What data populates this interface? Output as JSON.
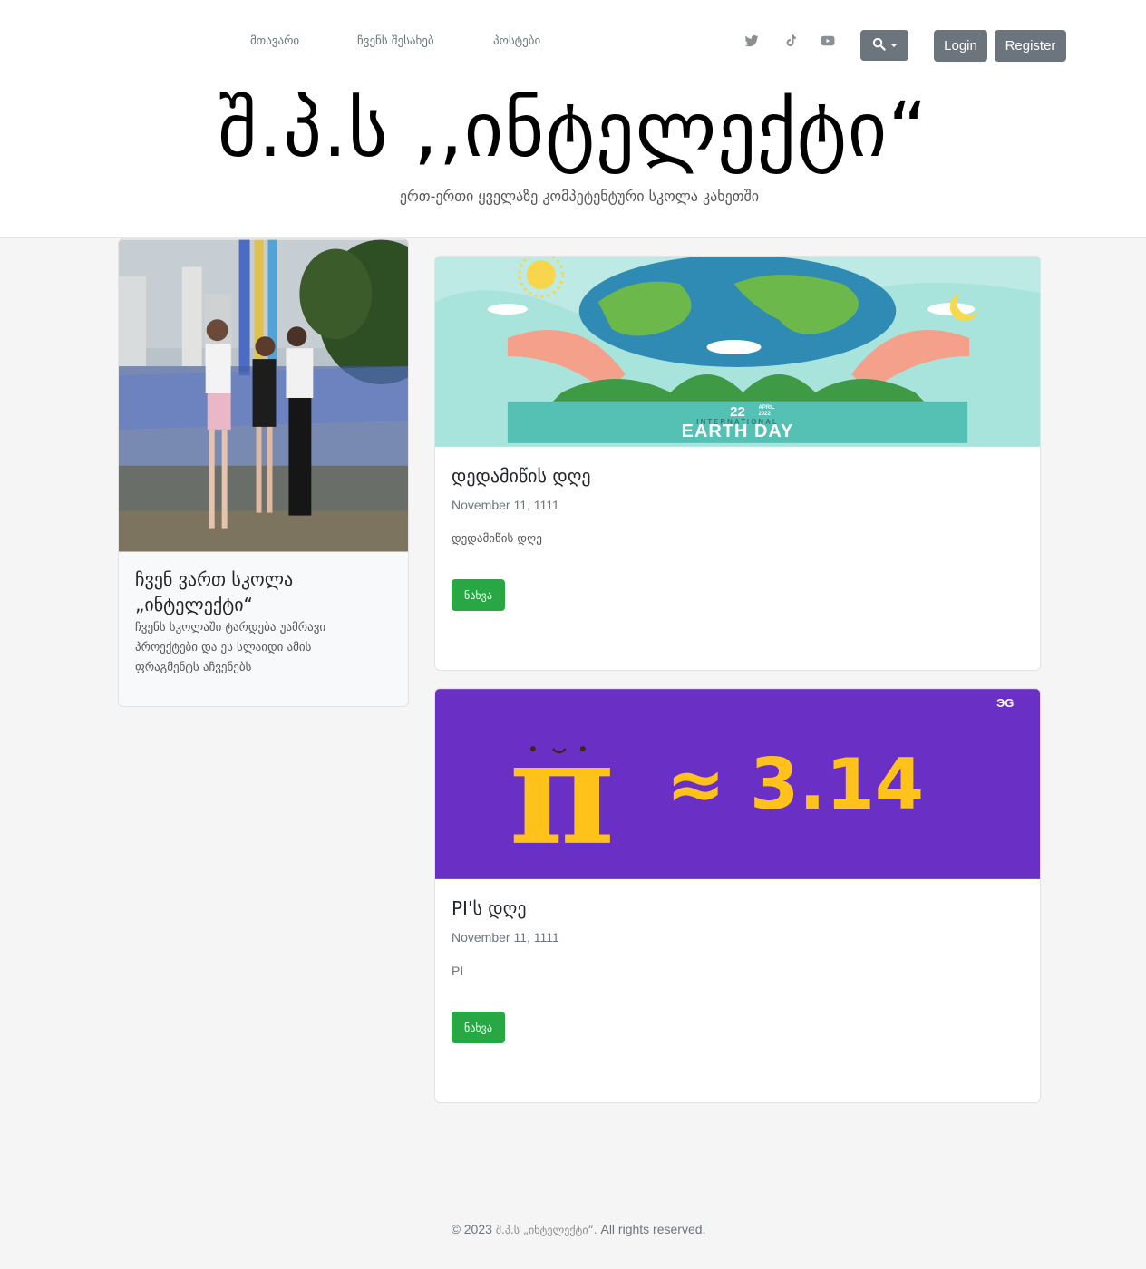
{
  "nav": {
    "home": "მთავარი",
    "about": "ჩვენს შესახებ",
    "posts": "პოსტები"
  },
  "social": [
    "twitter-icon",
    "tiktok-icon",
    "youtube-icon"
  ],
  "auth": {
    "login": "Login",
    "register": "Register"
  },
  "site": {
    "title": "შ.პ.ს ,,ინტელექტი“",
    "tagline": "ერთ-ერთი ყველაზე კომპეტენტური სკოლა კახეთში"
  },
  "sidebar_card": {
    "title_line1": "ჩვენ ვართ სკოლა",
    "title_line2": "„ინტელექტი“",
    "text_line1": "ჩვენს სკოლაში ტარდება უამრავი",
    "text_line2": "პროექტები და ეს სლაიდი ამის",
    "text_line3": "ფრაგმენტს აჩვენებს"
  },
  "posts": [
    {
      "title": "დედამიწის დღე",
      "date": "November 11, 1111",
      "excerpt": "დედამიწის დღე",
      "button": "ნახვა",
      "banner_top": "22",
      "banner_month": "APRIL",
      "banner_year": "2022",
      "banner_sub": "INTERNATIONAL",
      "banner_main": "EARTH DAY"
    },
    {
      "title": "PI'ს დღე",
      "date": "November 11, 1111",
      "excerpt": "PI",
      "button": "ნახვა",
      "banner_logo": "ЭG",
      "banner_symbol": "π",
      "banner_value": "≈ 3.14"
    }
  ],
  "footer": {
    "prefix": "© 2023",
    "brand": "შ.პ.ს „ინტელექტი“.",
    "suffix": "All rights reserved."
  },
  "colors": {
    "primary_gray": "#6c757d",
    "success_green": "#28a745",
    "pi_purple": "#6a2fc4",
    "pi_yellow": "#ffc21a",
    "earth_teal": "#a8e3dc"
  }
}
